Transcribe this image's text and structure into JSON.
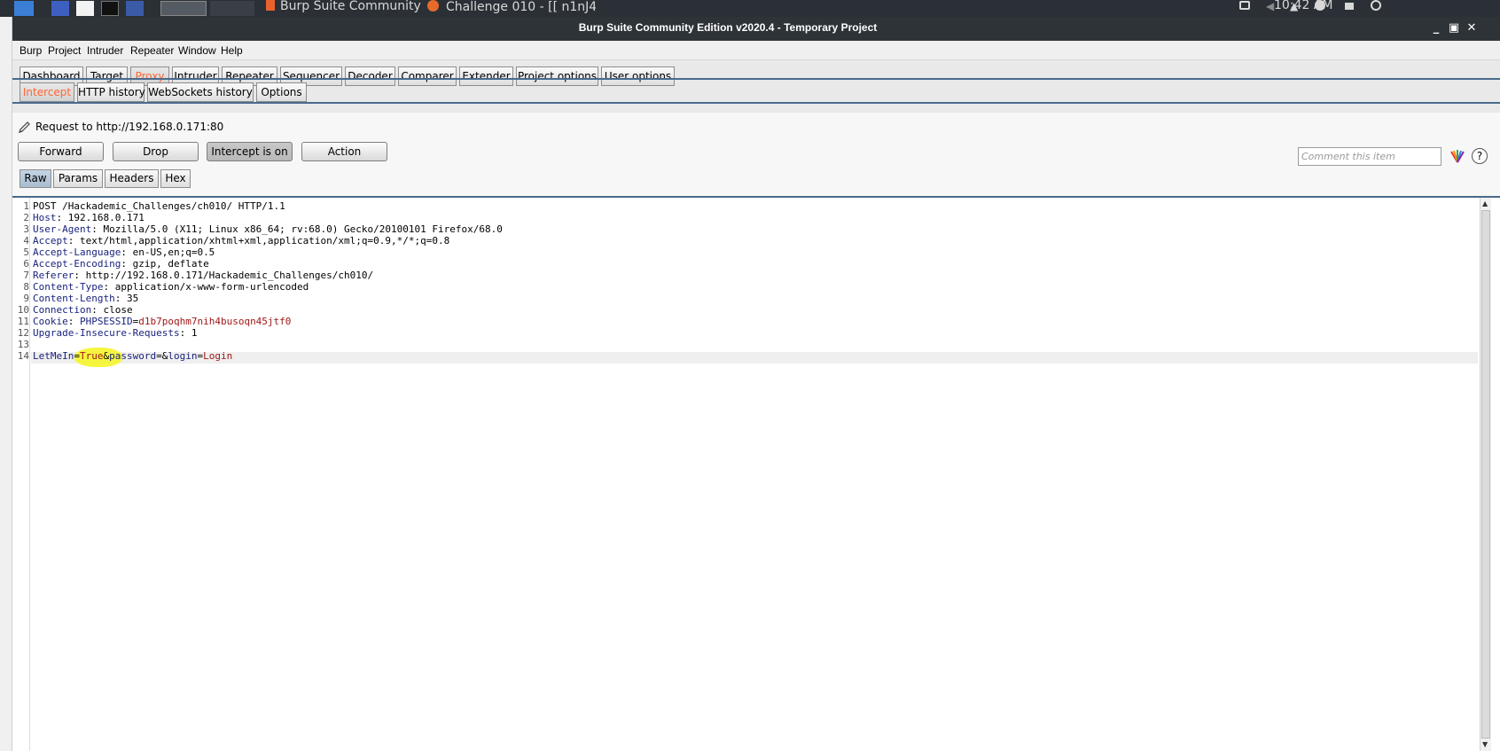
{
  "taskbar": {
    "windows": [
      {
        "label": "Burp Suite Community E..."
      },
      {
        "label": "Challenge 010 - [[ n1nJ4...."
      }
    ],
    "clock": "10:42 AM"
  },
  "window": {
    "title": "Burp Suite Community Edition v2020.4 - Temporary Project"
  },
  "menubar": {
    "items": [
      "Burp",
      "Project",
      "Intruder",
      "Repeater",
      "Window",
      "Help"
    ]
  },
  "main_tabs": [
    "Dashboard",
    "Target",
    "Proxy",
    "Intruder",
    "Repeater",
    "Sequencer",
    "Decoder",
    "Comparer",
    "Extender",
    "Project options",
    "User options"
  ],
  "main_tabs_active": "Proxy",
  "proxy_tabs": [
    "Intercept",
    "HTTP history",
    "WebSockets history",
    "Options"
  ],
  "proxy_tabs_active": "Intercept",
  "intercept": {
    "request_to": "Request to http://192.168.0.171:80",
    "buttons": {
      "forward": "Forward",
      "drop": "Drop",
      "intercept": "Intercept is on",
      "action": "Action"
    },
    "comment_placeholder": "Comment this item",
    "help": "?"
  },
  "message_tabs": [
    "Raw",
    "Params",
    "Headers",
    "Hex"
  ],
  "message_tabs_active": "Raw",
  "request": {
    "request_line": "POST /Hackademic_Challenges/ch010/ HTTP/1.1",
    "headers": [
      {
        "name": "Host",
        "value": "192.168.0.171"
      },
      {
        "name": "User-Agent",
        "value": "Mozilla/5.0 (X11; Linux x86_64; rv:68.0) Gecko/20100101 Firefox/68.0"
      },
      {
        "name": "Accept",
        "value": "text/html,application/xhtml+xml,application/xml;q=0.9,*/*;q=0.8"
      },
      {
        "name": "Accept-Language",
        "value": "en-US,en;q=0.5"
      },
      {
        "name": "Accept-Encoding",
        "value": "gzip, deflate"
      },
      {
        "name": "Referer",
        "value": "http://192.168.0.171/Hackademic_Challenges/ch010/"
      },
      {
        "name": "Content-Type",
        "value": "application/x-www-form-urlencoded"
      },
      {
        "name": "Content-Length",
        "value": "35"
      },
      {
        "name": "Connection",
        "value": "close"
      }
    ],
    "cookie": {
      "header": "Cookie",
      "name": "PHPSESSID",
      "value": "d1b7poqhm7nih4busoqn45jtf0"
    },
    "upgrade": {
      "name": "Upgrade-Insecure-Requests",
      "value": "1"
    },
    "body": [
      {
        "name": "LetMeIn",
        "value": "True"
      },
      {
        "name": "password",
        "value": ""
      },
      {
        "name": "login",
        "value": "Login"
      }
    ],
    "line_numbers": [
      "1",
      "2",
      "3",
      "4",
      "5",
      "6",
      "7",
      "8",
      "9",
      "10",
      "11",
      "12",
      "13",
      "14"
    ]
  },
  "colors": {
    "active_tab_text": "#ff6633",
    "header_name": "#1a237e",
    "param_value": "#a01818",
    "highlight": "#f5f52b"
  }
}
